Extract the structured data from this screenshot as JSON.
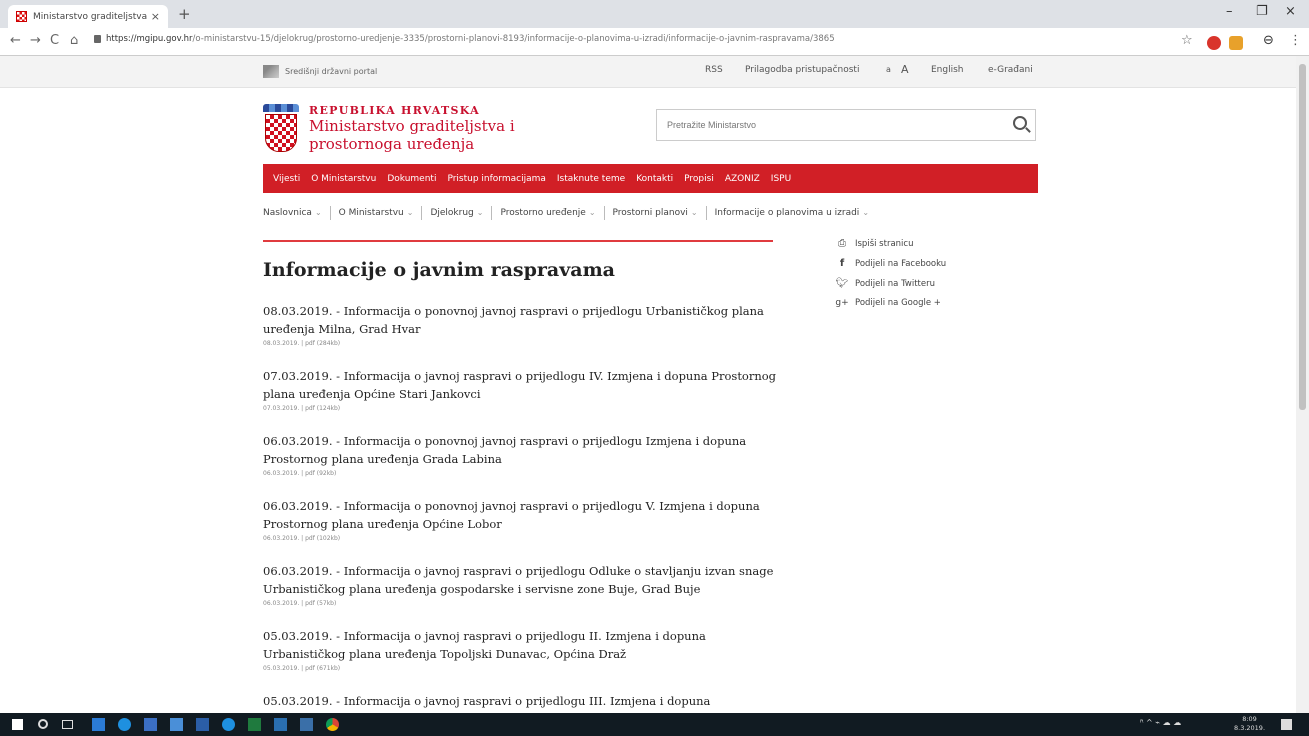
{
  "browser": {
    "tab_title": "Ministarstvo graditeljstva i prost",
    "tab_close": "×",
    "new_tab": "+",
    "url_host": "https://mgipu.gov.hr",
    "url_path": "/o-ministarstvu-15/djelokrug/prostorno-uredjenje-3335/prostorni-planovi-8193/informacije-o-planovima-u-izradi/informacije-o-javnim-raspravama/3865",
    "window_controls": {
      "minimize": "–",
      "restore": "❐",
      "close": "×"
    },
    "nav": {
      "back": "←",
      "forward": "→",
      "reload": "C",
      "home": "⌂"
    },
    "star": "☆",
    "profile": "⊖",
    "menu": "⋮"
  },
  "top_strip": {
    "portal_label": "Središnji državni portal",
    "links": [
      "RSS",
      "Prilagodba pristupačnosti",
      "a",
      "A",
      "English",
      "e-Građani"
    ]
  },
  "brand": {
    "line1": "REPUBLIKA HRVATSKA",
    "line2": "Ministarstvo graditeljstva i",
    "line3": "prostornoga uređenja"
  },
  "search": {
    "placeholder": "Pretražite Ministarstvo"
  },
  "main_nav": [
    "Vijesti",
    "O Ministarstvu",
    "Dokumenti",
    "Pristup informacijama",
    "Istaknute teme",
    "Kontakti",
    "Propisi",
    "AZONIZ",
    "ISPU"
  ],
  "breadcrumbs": [
    "Naslovnica",
    "O Ministarstvu",
    "Djelokrug",
    "Prostorno uređenje",
    "Prostorni planovi",
    "Informacije o planovima u izradi"
  ],
  "page": {
    "title": "Informacije o javnim raspravama"
  },
  "share": {
    "print": "Ispiši stranicu",
    "facebook": "Podijeli na Facebooku",
    "twitter": "Podijeli na Twitteru",
    "google": "Podijeli na Google +"
  },
  "items": [
    {
      "text": "08.03.2019. - Informacija o ponovnoj javnoj raspravi o prijedlogu Urbanističkog plana uređenja Milna, Grad Hvar",
      "meta": "08.03.2019. | pdf (284kb)"
    },
    {
      "text": "07.03.2019. - Informacija o javnoj raspravi o prijedlogu IV. Izmjena i dopuna Prostornog plana uređenja Općine Stari Jankovci",
      "meta": "07.03.2019. | pdf (124kb)"
    },
    {
      "text": "06.03.2019. - Informacija o ponovnoj javnoj raspravi o prijedlogu Izmjena i dopuna Prostornog plana uređenja Grada Labina",
      "meta": "06.03.2019. | pdf (92kb)"
    },
    {
      "text": "06.03.2019. - Informacija o ponovnoj javnoj raspravi o prijedlogu V. Izmjena i dopuna Prostornog plana uređenja Općine Lobor",
      "meta": "06.03.2019. | pdf (102kb)"
    },
    {
      "text": "06.03.2019. - Informacija o javnoj raspravi o prijedlogu Odluke o stavljanju izvan snage Urbanističkog plana uređenja gospodarske i servisne zone Buje, Grad Buje",
      "meta": "06.03.2019. | pdf (57kb)"
    },
    {
      "text": "05.03.2019. - Informacija o javnoj raspravi o prijedlogu II. Izmjena i dopuna Urbanističkog plana uređenja Topoljski Dunavac, Općina Draž",
      "meta": "05.03.2019. | pdf (671kb)"
    },
    {
      "text": "05.03.2019. - Informacija o javnoj raspravi o prijedlogu III. Izmjena i dopuna",
      "meta": ""
    }
  ],
  "taskbar": {
    "time": "8:09",
    "date": "8.3.2019.",
    "tray": "ᴿ ^ ⌁ ☁ ☁"
  }
}
